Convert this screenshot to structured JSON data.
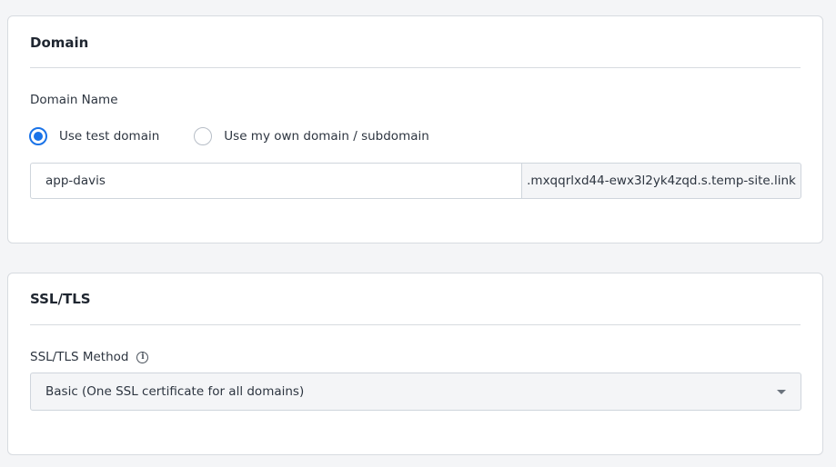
{
  "domain_section": {
    "title": "Domain",
    "field_label": "Domain Name",
    "radio_options": [
      {
        "label": "Use test domain",
        "checked": true
      },
      {
        "label": "Use my own domain / subdomain",
        "checked": false
      }
    ],
    "subdomain_value": "app-davis",
    "domain_suffix": ".mxqqrlxd44-ewx3l2yk4zqd.s.temp-site.link"
  },
  "ssl_section": {
    "title": "SSL/TLS",
    "field_label": "SSL/TLS Method",
    "info_icon": "info-icon",
    "selected_method": "Basic (One SSL certificate for all domains)"
  },
  "colors": {
    "accent": "#1a73e8",
    "border": "#d7dbe0",
    "background": "#f4f5f7"
  }
}
